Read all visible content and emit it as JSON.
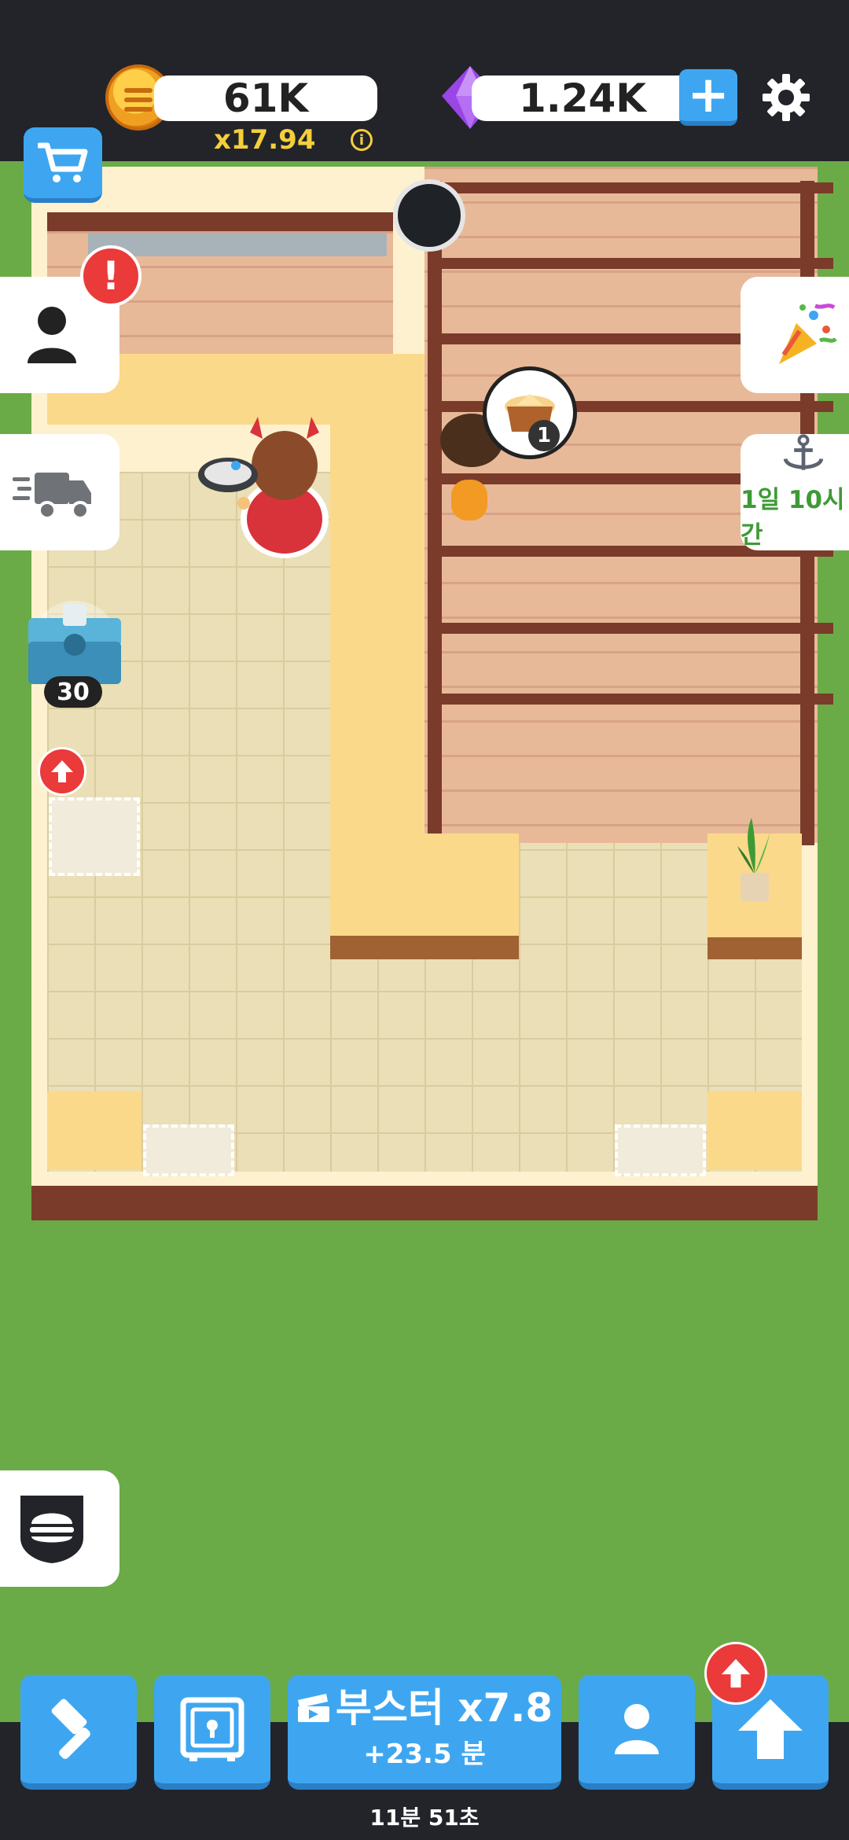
{
  "top_bar": {
    "coins": "61K",
    "multiplier": "x17.94",
    "info_icon": "i",
    "gems": "1.24K",
    "add_gems_label": "+"
  },
  "side_left": {
    "alert_mark": "!",
    "chest_count": "30"
  },
  "side_right": {
    "anchor_timer": "1일 10시간"
  },
  "bubble": {
    "order_count": "1"
  },
  "bottom_nav": {
    "boost_label": "부스터 x7.8",
    "boost_time": "+23.5 분",
    "timer": "11분 51초"
  },
  "colors": {
    "accent_blue": "#3ea6f0",
    "alert_red": "#ea3a3a",
    "grass": "#6bab47",
    "gold": "#f5cf3a",
    "timer_green": "#3e9a35"
  },
  "icons": [
    "coin-icon",
    "gem-icon",
    "plus-icon",
    "gear-icon",
    "cart-icon",
    "user-icon",
    "truck-icon",
    "party-popper-icon",
    "anchor-icon",
    "chest-icon",
    "arrow-up-icon",
    "burger-icon",
    "hammer-icon",
    "safe-icon",
    "ticket-icon",
    "person-icon"
  ]
}
